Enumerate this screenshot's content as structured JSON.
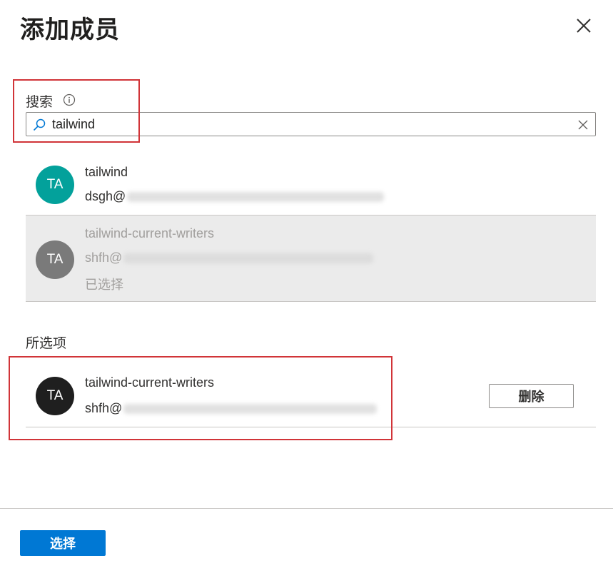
{
  "panel": {
    "title": "添加成员"
  },
  "search": {
    "label": "搜索",
    "value": "tailwind"
  },
  "results": [
    {
      "initials": "TA",
      "name": "tailwind",
      "email_prefix": "dsgh@",
      "avatar_color": "#03a19b"
    },
    {
      "initials": "TA",
      "name": "tailwind-current-writers",
      "email_prefix": "shfh@",
      "status": "已选择",
      "avatar_color": "#7a7a7a"
    }
  ],
  "selected": {
    "label": "所选项",
    "items": [
      {
        "initials": "TA",
        "name": "tailwind-current-writers",
        "email_prefix": "shfh@",
        "remove_label": "删除",
        "avatar_color": "#1f1f1f"
      }
    ]
  },
  "footer": {
    "select_label": "选择"
  },
  "colors": {
    "primary": "#0078d4",
    "highlight": "#d13438",
    "selected_bg": "#ebebeb"
  }
}
